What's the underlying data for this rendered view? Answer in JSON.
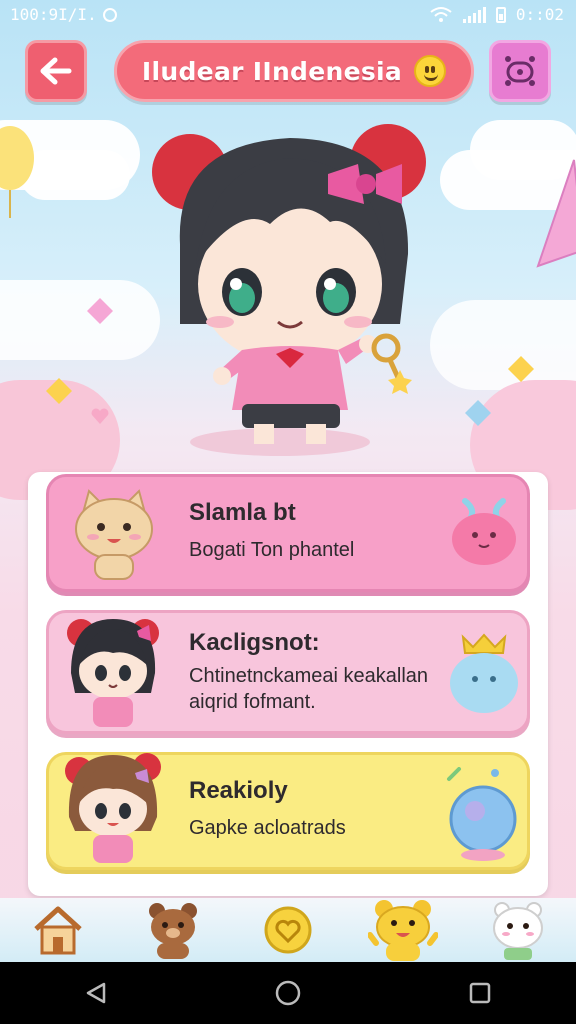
{
  "status_bar": {
    "time_left": "100:9I/I.",
    "time_right": "0::02"
  },
  "header": {
    "back_icon": "arrow-left-icon",
    "title": "Iludear IIndenesia",
    "title_emoji": "smiley-icon",
    "menu_icon": "game-controller-icon"
  },
  "cards": [
    {
      "title": "Slamla bt",
      "description": "Bogati Ton phantel",
      "icon": "cat-sticker",
      "decor": "pink-blob"
    },
    {
      "title": "Kaclіgsnot:",
      "description": "Chtinetnckameai keakallan aiqrid fofmant.",
      "icon": "girl-sticker",
      "decor": "blue-crown-blob"
    },
    {
      "title": "Reakioly",
      "description": "Gapke acloatrads",
      "icon": "brown-hair-girl-sticker",
      "decor": "crystal-ball"
    }
  ],
  "bottom_nav": [
    {
      "name": "home",
      "icon": "house-icon"
    },
    {
      "name": "bear",
      "icon": "bear-icon"
    },
    {
      "name": "heart",
      "icon": "heart-coin-icon"
    },
    {
      "name": "yellow-bear",
      "icon": "yellow-bear-icon"
    },
    {
      "name": "white-cat",
      "icon": "white-cat-icon"
    }
  ],
  "system_nav": {
    "back": "back-triangle-icon",
    "home": "home-circle-icon",
    "recents": "recents-square-icon"
  },
  "colors": {
    "title_pill": "#f36b7a",
    "back_button": "#ef5f70",
    "menu_button": "#e77cd1",
    "card1": "#f7a0c8",
    "card2": "#f8c5dc",
    "card3": "#faec83"
  }
}
